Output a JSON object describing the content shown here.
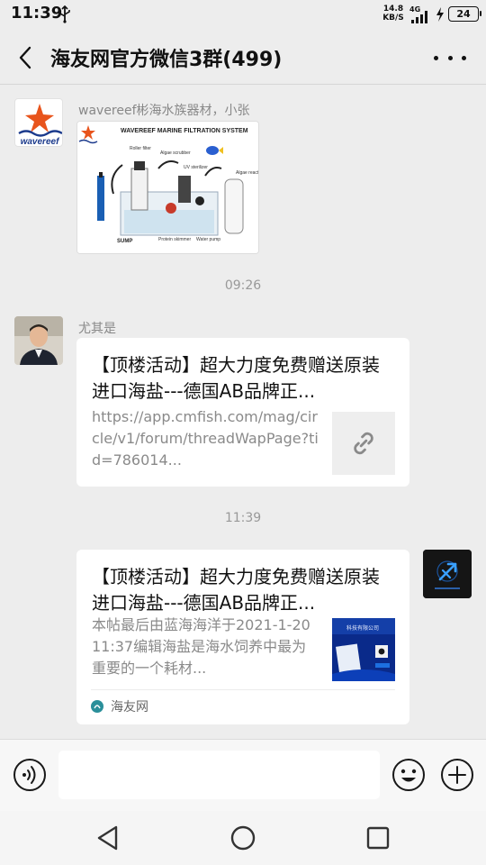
{
  "status": {
    "time": "11:39",
    "net_speed_value": "14.8",
    "net_speed_unit": "KB/S",
    "network_gen": "4G",
    "battery": "24"
  },
  "header": {
    "title": "海友网官方微信3群(499)"
  },
  "messages": [
    {
      "sender": "wavereef彬海水族器材，小张",
      "type": "image",
      "avatar_logo_text": "wavereef",
      "image_title": "WAVEREEF MARINE FILTRATION SYSTEM",
      "image_labels": [
        "SUMP",
        "Protein skimmer",
        "Water pump",
        "Algae scrubber",
        "UV sterilizer",
        "Roller filter",
        "Algae reactor"
      ]
    },
    {
      "time_separator": "09:26"
    },
    {
      "sender": "尤其是",
      "type": "link",
      "title": "【顶楼活动】超大力度免费赠送原装进口海盐---德国AB品牌正...",
      "description": "https://app.cmfish.com/mag/circle/v1/forum/threadWapPage?tid=786014...",
      "thumb_icon": "link-icon"
    },
    {
      "time_separator": "11:39"
    },
    {
      "sender": "self",
      "type": "article",
      "title": "【顶楼活动】超大力度免费赠送原装进口海盐---德国AB品牌正...",
      "description": "本帖最后由蓝海海洋于2021-1-2011:37编辑海盐是海水饲养中最为重要的一个耗材...",
      "source": "海友网",
      "thumb_text": "科技有限公司"
    }
  ],
  "input": {
    "placeholder": "",
    "value": ""
  },
  "colors": {
    "background": "#ededed",
    "card": "#ffffff",
    "secondary_text": "#8a8a8a",
    "wavereef_orange": "#e8541c",
    "wavereef_blue": "#1b3a8c"
  }
}
